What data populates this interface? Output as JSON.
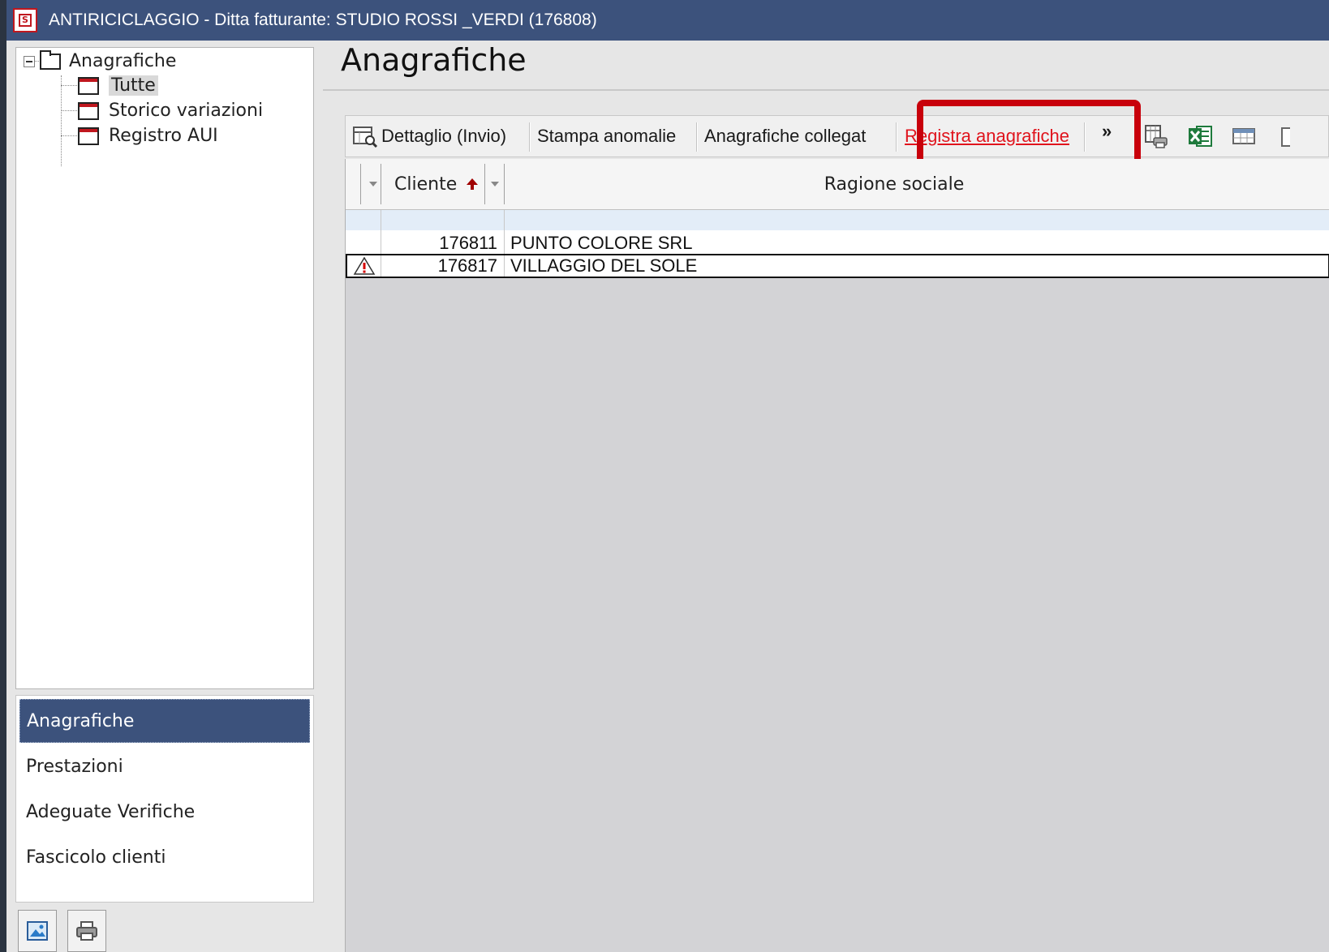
{
  "window": {
    "title": "ANTIRICICLAGGIO - Ditta fatturante: STUDIO ROSSI _VERDI (176808)",
    "accent": "#3c527c",
    "highlight": "#c8000b"
  },
  "tree": {
    "root": "Anagrafiche",
    "children": [
      "Tutte",
      "Storico variazioni",
      "Registro AUI"
    ],
    "selected": "Tutte"
  },
  "nav": {
    "items": [
      "Anagrafiche",
      "Prestazioni",
      "Adeguate Verifiche",
      "Fascicolo clienti"
    ],
    "active": "Anagrafiche"
  },
  "main": {
    "title": "Anagrafiche"
  },
  "toolbar": {
    "dettaglio": "Dettaglio (Invio)",
    "stampa": "Stampa anomalie",
    "collegate": "Anagrafiche collegat",
    "registra": "Registra anagrafiche",
    "more": "»",
    "icons": [
      "print-preview-icon",
      "excel-icon",
      "table-icon"
    ]
  },
  "grid": {
    "columns": [
      "Cliente",
      "Ragione sociale"
    ],
    "sort": "Cliente ascending",
    "rows": [
      {
        "cliente": "176811",
        "ragione": "PUNTO COLORE SRL",
        "warning": false
      },
      {
        "cliente": "176817",
        "ragione": "VILLAGGIO DEL SOLE",
        "warning": true
      }
    ]
  }
}
